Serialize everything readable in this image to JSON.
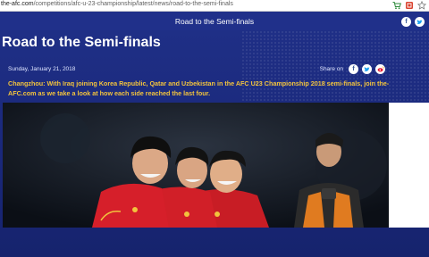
{
  "browser": {
    "url_domain": "the-afc.com",
    "url_path": "/competitions/afc-u-23-championship/latest/news/road-to-the-semi-finals"
  },
  "header": {
    "title": "Road to the Semi-finals"
  },
  "article": {
    "title": "Road to the Semi-finals",
    "date": "Sunday, January 21, 2018",
    "share_label": "Share on",
    "lead": "Changzhou: With Iraq joining Korea Republic, Qatar and Uzbekistan in the AFC U23 Championship 2018 semi-finals, join the-AFC.com as we take a look at how each side reached the last four."
  },
  "colors": {
    "brand_blue": "#20308a",
    "lead_yellow": "#f2c33d",
    "facebook": "#3b5998",
    "twitter": "#1da1f2",
    "weibo": "#e6162d"
  },
  "icons": [
    "cart-icon",
    "extension-icon",
    "star-icon",
    "facebook-icon",
    "twitter-icon",
    "weibo-icon"
  ]
}
